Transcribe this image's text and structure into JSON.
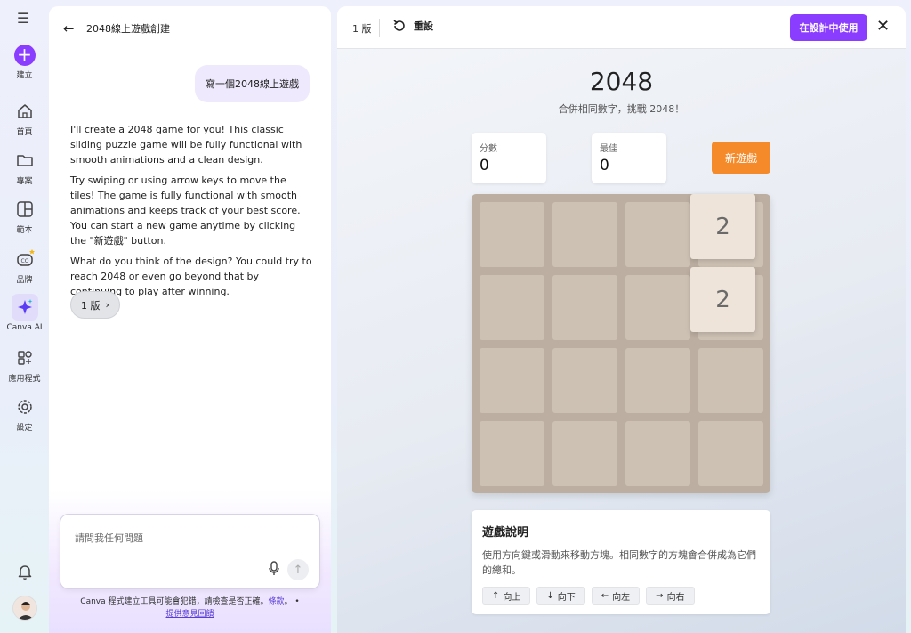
{
  "rail": {
    "items": [
      {
        "label": "建立",
        "icon": "plus-icon"
      },
      {
        "label": "首頁",
        "icon": "home-icon"
      },
      {
        "label": "專案",
        "icon": "folder-icon"
      },
      {
        "label": "範本",
        "icon": "template-icon"
      },
      {
        "label": "品牌",
        "icon": "brand-icon"
      },
      {
        "label": "Canva AI",
        "icon": "sparkle-icon"
      },
      {
        "label": "應用程式",
        "icon": "apps-icon"
      },
      {
        "label": "設定",
        "icon": "gear-icon"
      }
    ]
  },
  "chat": {
    "title": "2048線上遊戲創建",
    "user_message": "寫一個2048線上遊戲",
    "assistant_paragraphs": [
      "I'll create a 2048 game for you! This classic sliding puzzle game will be fully functional with smooth animations and a clean design.",
      "Try swiping or using arrow keys to move the tiles! The game is fully functional with smooth animations and keeps track of your best score. You can start a new game anytime by clicking the \"新遊戲\" button.",
      "What do you think of the design? You could try to reach 2048 or even go beyond that by continuing to play after winning."
    ],
    "version_chip": "1 版",
    "input_placeholder": "請問我任何問題",
    "disclaimer_text": "Canva 程式建立工具可能會犯錯，請檢查是否正確。",
    "disclaimer_link1": "條款",
    "disclaimer_sep": "。 •",
    "disclaimer_link2": "提供意見回饋"
  },
  "toolbar": {
    "version": "1 版",
    "reset_label": "重設",
    "use_in_design_label": "在設計中使用",
    "close_label": "✕"
  },
  "game": {
    "title": "2048",
    "subtitle": "合併相同數字，挑戰 2048！",
    "score_label": "分數",
    "score_value": "0",
    "best_label": "最佳",
    "best_value": "0",
    "new_game_label": "新遊戲",
    "tiles": [
      {
        "value": "2",
        "row": 0,
        "col": 3
      },
      {
        "value": "2",
        "row": 1,
        "col": 3
      }
    ],
    "help_title": "遊戲說明",
    "help_text": "使用方向鍵或滑動來移動方塊。相同數字的方塊會合併成為它們的總和。",
    "keys": [
      {
        "arrow": "↑",
        "label": "向上"
      },
      {
        "arrow": "↓",
        "label": "向下"
      },
      {
        "arrow": "←",
        "label": "向左"
      },
      {
        "arrow": "→",
        "label": "向右"
      }
    ]
  },
  "colors": {
    "accent": "#8b3dff",
    "new_game_button": "#f58a2a",
    "board_bg": "#bcaea1",
    "empty_cell": "#cdc1b4",
    "tile_2": "#eee4da"
  }
}
